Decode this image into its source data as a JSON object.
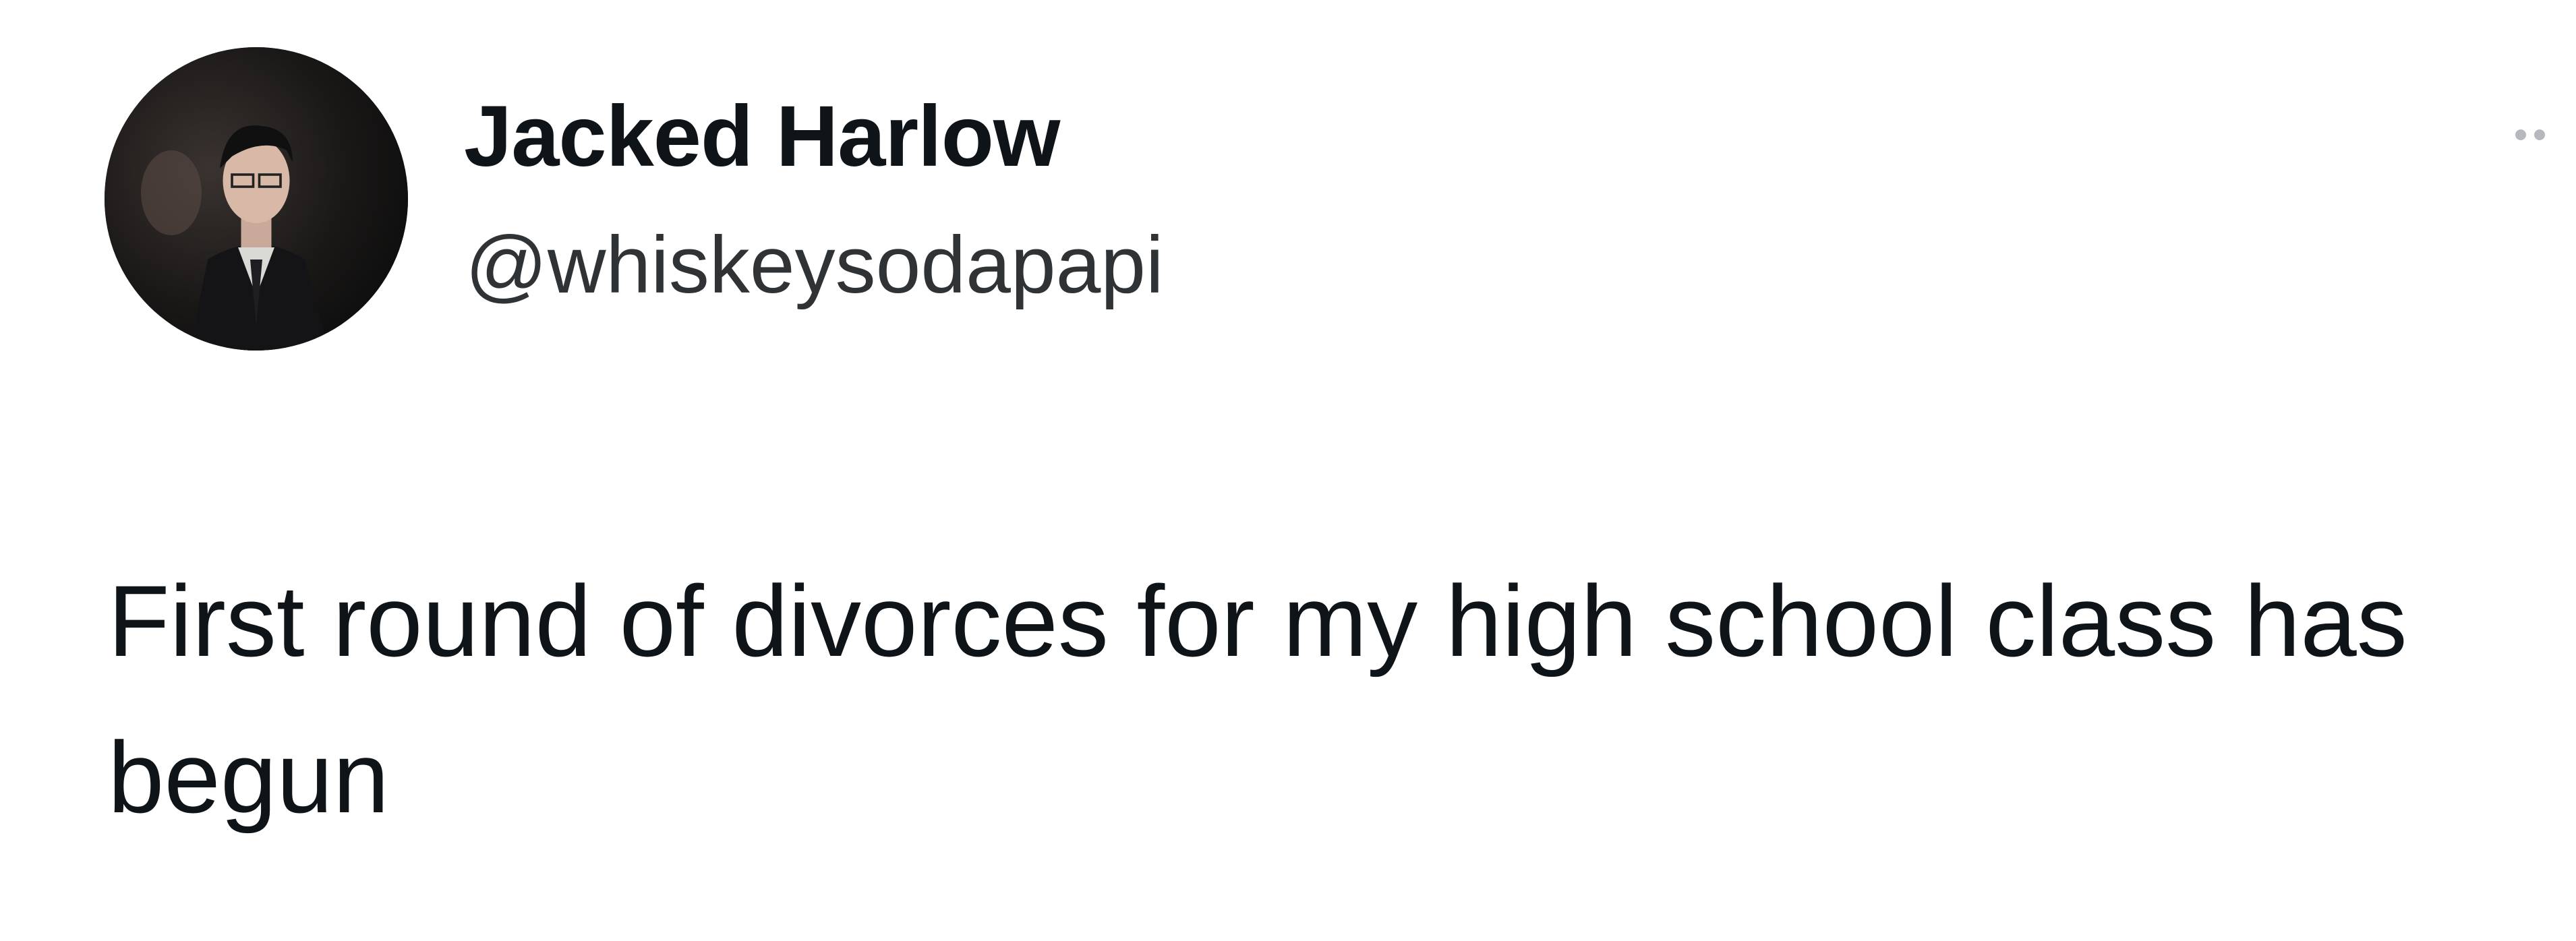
{
  "tweet": {
    "author": {
      "display_name": "Jacked Harlow",
      "handle": "@whiskeysodapapi",
      "avatar_icon": "profile-photo"
    },
    "text": "First round of divorces for my high school class has begun",
    "more_icon": "more-options-icon"
  },
  "colors": {
    "background": "#ffffff",
    "text_primary": "#0f1419",
    "text_secondary": "#2f3336",
    "more_dots": "#b5b9bd"
  }
}
